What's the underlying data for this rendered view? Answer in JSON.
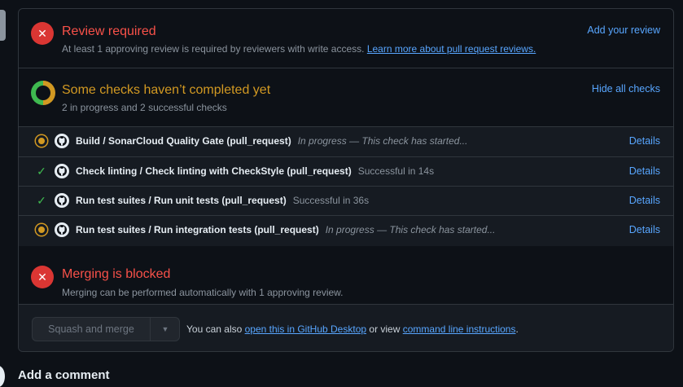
{
  "review": {
    "title": "Review required",
    "description": "At least 1 approving review is required by reviewers with write access.",
    "learn_more_link": "Learn more about pull request reviews.",
    "add_review_link": "Add your review"
  },
  "checks": {
    "title": "Some checks haven’t completed yet",
    "summary": "2 in progress and 2 successful checks",
    "hide_link": "Hide all checks",
    "items": [
      {
        "status": "in-progress",
        "name": "Build / SonarCloud Quality Gate (pull_request)",
        "description": "In progress — This check has started...",
        "details": "Details"
      },
      {
        "status": "success",
        "name": "Check linting / Check linting with CheckStyle (pull_request)",
        "description": "Successful in 14s",
        "details": "Details"
      },
      {
        "status": "success",
        "name": "Run test suites / Run unit tests (pull_request)",
        "description": "Successful in 36s",
        "details": "Details"
      },
      {
        "status": "in-progress",
        "name": "Run test suites / Run integration tests (pull_request)",
        "description": "In progress — This check has started...",
        "details": "Details"
      }
    ]
  },
  "merge": {
    "title": "Merging is blocked",
    "description": "Merging can be performed automatically with 1 approving review."
  },
  "actions": {
    "merge_button": "Squash and merge",
    "prefix_text": "You can also",
    "desktop_link": "open this in GitHub Desktop",
    "or_view_text": "or view",
    "cli_link": "command line instructions",
    "suffix_text": "."
  },
  "comment": {
    "heading": "Add a comment"
  },
  "colors": {
    "error": "#da3633",
    "warning": "#d29922",
    "success": "#3fb950",
    "link": "#58a6ff"
  }
}
